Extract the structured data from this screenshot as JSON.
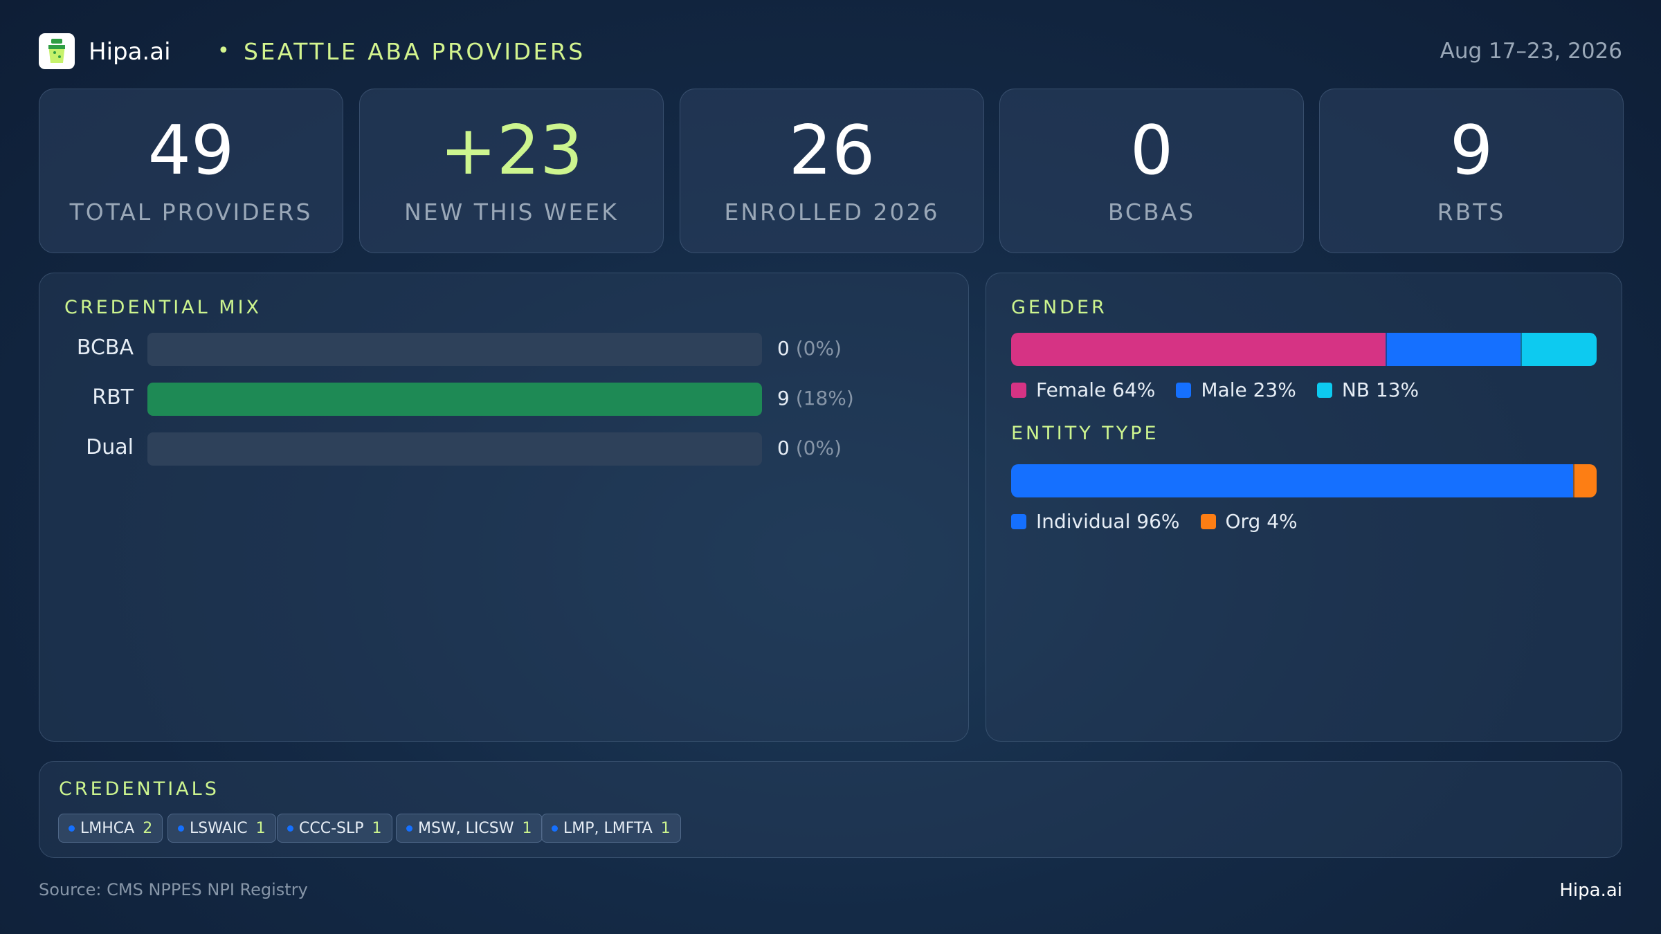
{
  "header": {
    "brand": "Hipa.ai",
    "separator": "•",
    "region": "SEATTLE ABA PROVIDERS",
    "date_range": "Aug 17–23, 2026",
    "logo_icon": "clipboard-cup-icon"
  },
  "stats": [
    {
      "value": "49",
      "label": "TOTAL PROVIDERS"
    },
    {
      "value": "+23",
      "label": "NEW THIS WEEK"
    },
    {
      "value": "26",
      "label": "ENROLLED 2026"
    },
    {
      "value": "0",
      "label": "BCBAS"
    },
    {
      "value": "9",
      "label": "RBTS"
    }
  ],
  "credential_mix": {
    "title": "CREDENTIAL MIX",
    "rows": [
      {
        "name": "BCBA",
        "count": "0",
        "pct": "(0%)",
        "fraction": 0
      },
      {
        "name": "RBT",
        "count": "9",
        "pct": "(18%)",
        "fraction": 1
      },
      {
        "name": "Dual",
        "count": "0",
        "pct": "(0%)",
        "fraction": 0
      }
    ],
    "fill_color": "#1e8a55"
  },
  "gender": {
    "title": "GENDER",
    "segments": [
      {
        "label": "Female 64%",
        "percent": 64,
        "color": "#d63384"
      },
      {
        "label": "Male 23%",
        "percent": 23,
        "color": "#1570ff"
      },
      {
        "label": "NB 13%",
        "percent": 13,
        "color": "#0dcaf0"
      }
    ]
  },
  "entity_type": {
    "title": "ENTITY TYPE",
    "segments": [
      {
        "label": "Individual 96%",
        "percent": 96,
        "color": "#1570ff"
      },
      {
        "label": "Org 4%",
        "percent": 4,
        "color": "#fd7e14"
      }
    ]
  },
  "credentials": {
    "title": "CREDENTIALS",
    "chips": [
      {
        "name": "LMHCA",
        "count": "2"
      },
      {
        "name": "LSWAIC",
        "count": "1"
      },
      {
        "name": "CCC-SLP",
        "count": "1"
      },
      {
        "name": "MSW, LICSW",
        "count": "1"
      },
      {
        "name": "LMP, LMFTA",
        "count": "1"
      }
    ]
  },
  "footer": {
    "source": "Source: CMS NPPES NPI Registry",
    "brand": "Hipa.ai"
  }
}
